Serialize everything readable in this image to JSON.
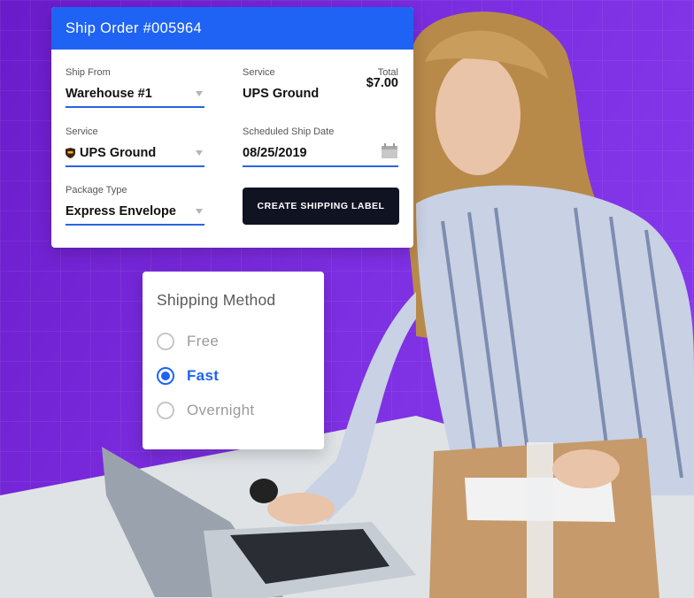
{
  "order_card": {
    "title": "Ship Order #005964",
    "ship_from": {
      "label": "Ship From",
      "value": "Warehouse #1"
    },
    "service_summary": {
      "label": "Service",
      "value": "UPS Ground"
    },
    "total": {
      "label": "Total",
      "value": "$7.00"
    },
    "service": {
      "label": "Service",
      "value": "UPS Ground"
    },
    "ship_date": {
      "label": "Scheduled Ship Date",
      "value": "08/25/2019"
    },
    "package_type": {
      "label": "Package Type",
      "value": "Express Envelope"
    },
    "create_button": "CREATE SHIPPING LABEL"
  },
  "shipping_method": {
    "title": "Shipping Method",
    "options": [
      {
        "label": "Free",
        "selected": false
      },
      {
        "label": "Fast",
        "selected": true
      },
      {
        "label": "Overnight",
        "selected": false
      }
    ]
  },
  "colors": {
    "accent": "#1e63f3",
    "background": "#7b2de0",
    "button": "#101322"
  }
}
